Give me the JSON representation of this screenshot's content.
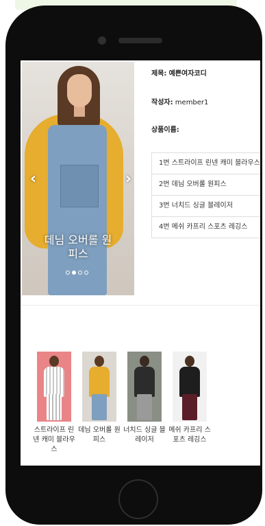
{
  "carousel": {
    "caption": "데님 오버롤 원피스",
    "prev_icon": "chevron-left-icon",
    "next_icon": "chevron-right-icon",
    "slide_count": 4,
    "active_slide": 2
  },
  "post": {
    "title_label": "제목:",
    "title_value": "예쁜여자코디",
    "author_label": "작성자:",
    "author_value": "member1",
    "products_label": "상품이름:"
  },
  "products": [
    "1번  스트라이프 린넨 캐미 블라우스",
    "2번  데님 오버롤 원피스",
    "3번  너치드 싱글 블레이저",
    "4번  메쉬 카프리 스포츠 레깅스"
  ],
  "thumbnails": [
    {
      "name": "스트라이프 린넨 캐미 블라우스",
      "bg": "#e98487"
    },
    {
      "name": "데님 오버롤 원피스",
      "bg": "#dcd7d1"
    },
    {
      "name": "너치드 싱글 블레이저",
      "bg": "#8a8f86"
    },
    {
      "name": "메쉬 카프리 스포츠 레깅스",
      "bg": "#f1f1f1"
    }
  ]
}
